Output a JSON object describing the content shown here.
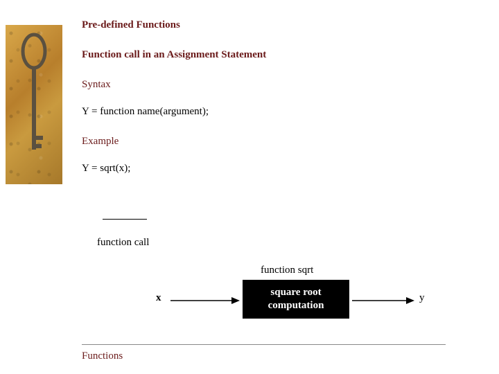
{
  "title": "Pre-defined Functions",
  "subtitle": "Function call in an Assignment Statement",
  "syntax_label": "Syntax",
  "syntax_code": "Y = function name(argument);",
  "example_label": "Example",
  "example_code": "Y = sqrt(x);",
  "function_call_label": "function call",
  "diagram": {
    "func_label": "function sqrt",
    "input": "x",
    "box_line1": "square root",
    "box_line2": "computation",
    "output": "y"
  },
  "footer": "Functions"
}
